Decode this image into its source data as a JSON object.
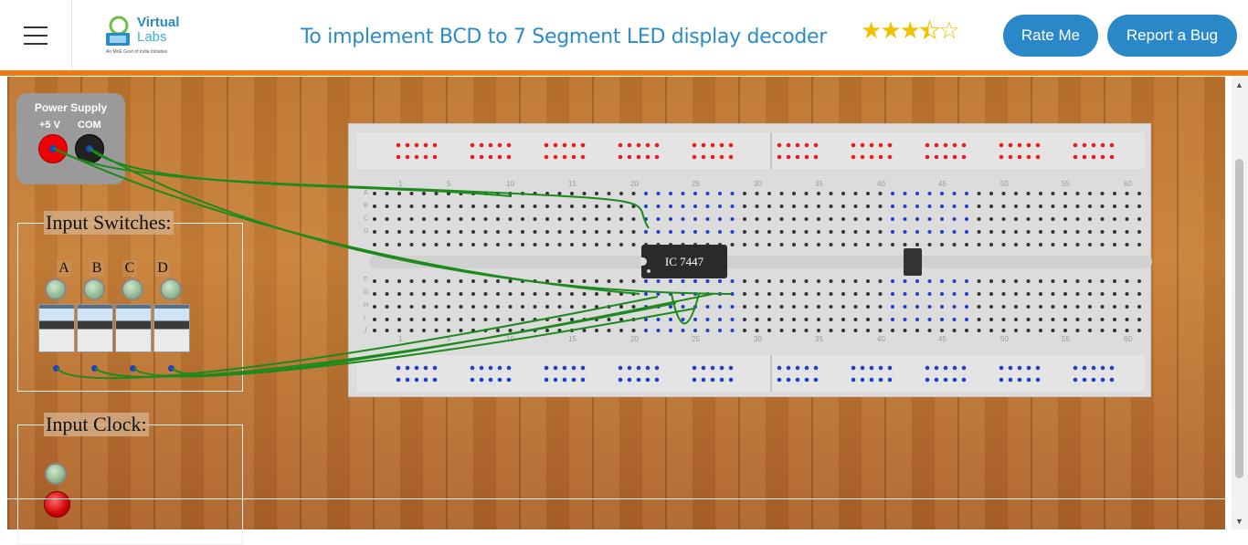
{
  "header": {
    "logo_line1": "Virtual",
    "logo_line2": "Labs",
    "logo_tagline": "An MoE Govt of India Initiative",
    "title": "To implement BCD to 7 Segment LED display decoder",
    "rating": {
      "value": 3.5,
      "max": 5
    },
    "rate_button": "Rate Me",
    "bug_button": "Report a Bug"
  },
  "colors": {
    "accent_orange": "#f07a12",
    "button_blue": "#2a87c8",
    "title_blue": "#2b8bc9",
    "star_gold": "#f2c200"
  },
  "power_supply": {
    "title": "Power Supply",
    "plus_label": "+5 V",
    "com_label": "COM"
  },
  "input_switches": {
    "title": "Input Switches:",
    "labels": [
      "A",
      "B",
      "C",
      "D"
    ]
  },
  "input_clock": {
    "title": "Input Clock:"
  },
  "breadboard": {
    "ic_label": "IC 7447",
    "column_numbers": [
      "1",
      "5",
      "10",
      "15",
      "20",
      "25",
      "30",
      "35",
      "40",
      "45",
      "50",
      "55",
      "60"
    ],
    "row_letters_top": [
      "A",
      "B",
      "C",
      "D",
      "E"
    ],
    "row_letters_bottom": [
      "F",
      "G",
      "H",
      "I",
      "J"
    ]
  },
  "icons": {
    "menu": "hamburger-icon",
    "star": "star-icon",
    "cursor": "mouse-pointer-icon"
  }
}
